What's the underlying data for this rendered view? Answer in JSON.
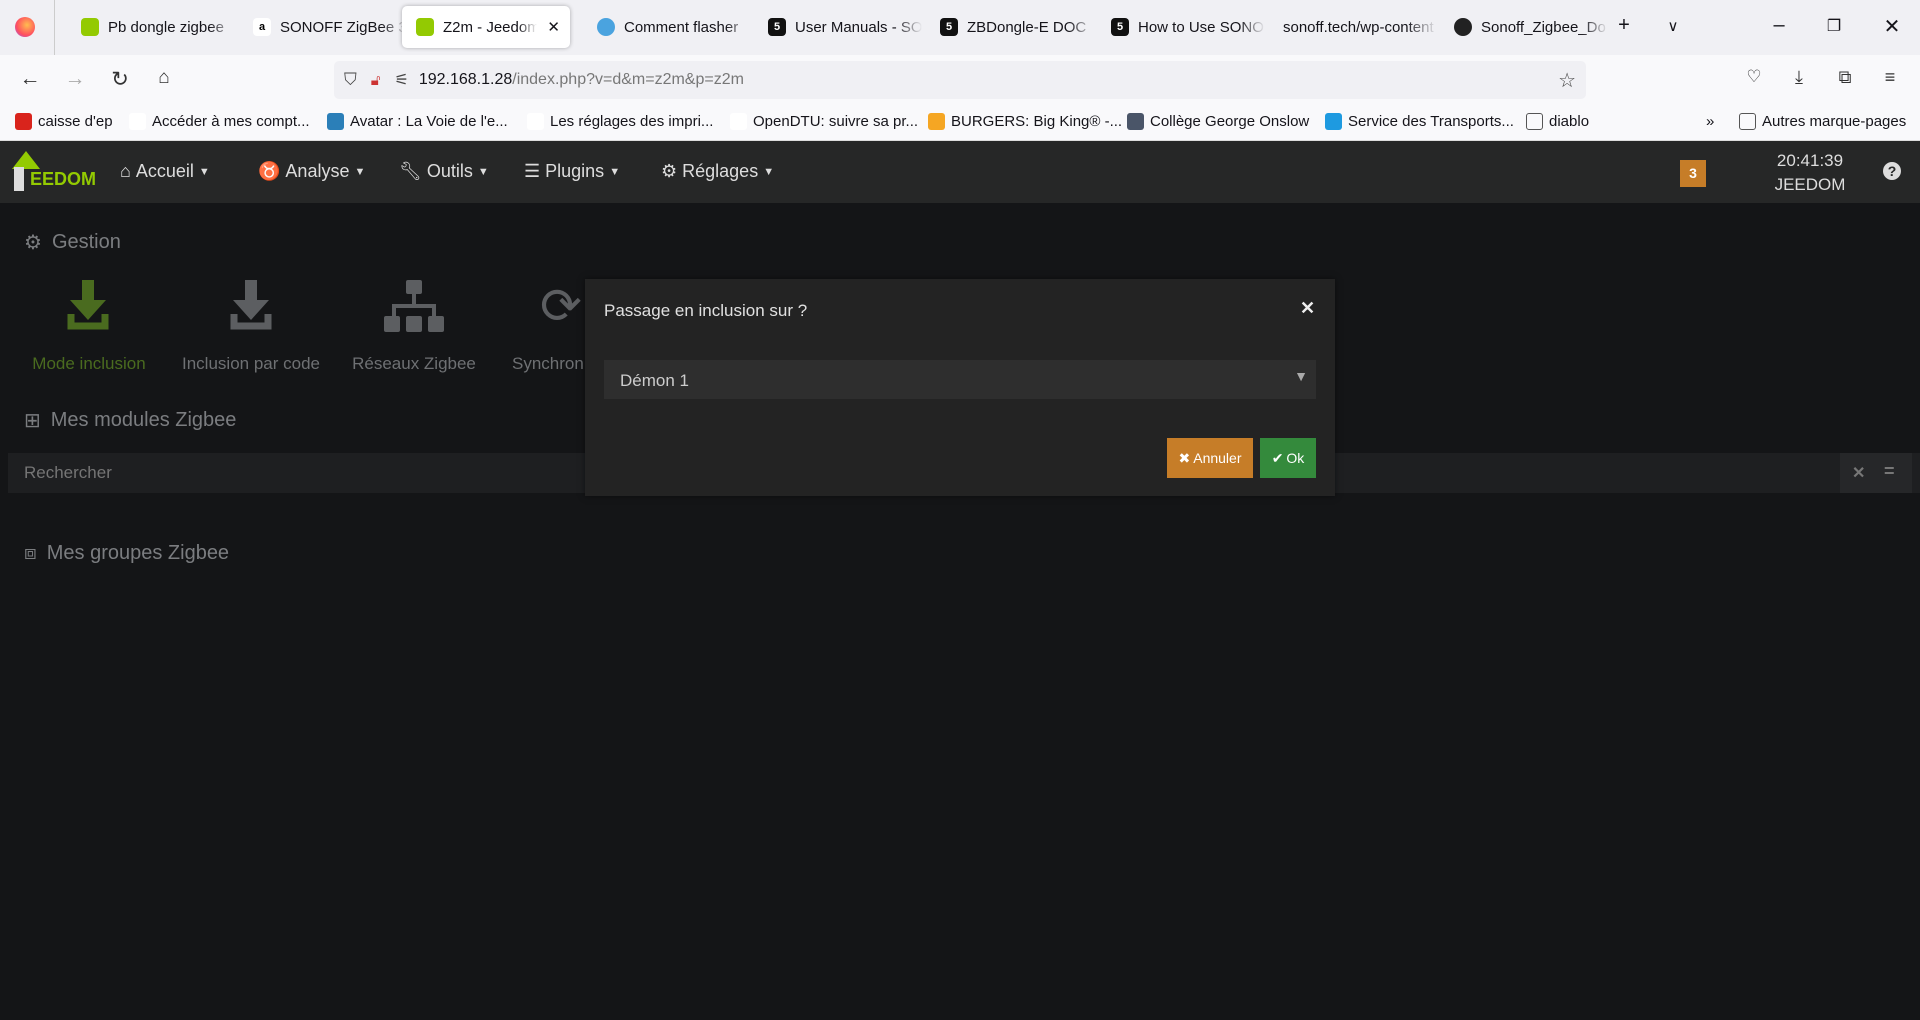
{
  "browser": {
    "tabs": [
      {
        "title": "Pb dongle zigbee",
        "icon": "jeedom-icon"
      },
      {
        "title": "SONOFF ZigBee 3",
        "icon": "amazon-icon"
      },
      {
        "title": "Z2m - Jeedom",
        "icon": "jeedom-icon",
        "active": true
      },
      {
        "title": "Comment flasher",
        "icon": "globe-icon"
      },
      {
        "title": "User Manuals - SO",
        "icon": "sonoff-icon"
      },
      {
        "title": "ZBDongle-E DOC",
        "icon": "sonoff-icon"
      },
      {
        "title": "How to Use SONO",
        "icon": "sonoff-icon"
      },
      {
        "title": "sonoff.tech/wp-content",
        "icon": "none"
      },
      {
        "title": "Sonoff_Zigbee_Do",
        "icon": "github-icon"
      }
    ],
    "url_host": "192.168.1.28",
    "url_path": "/index.php?v=d&m=z2m&p=z2m",
    "bookmarks": [
      "caisse d'ep",
      "Accéder à mes compt...",
      "Avatar : La Voie de l'e...",
      "Les réglages des impri...",
      "OpenDTU: suivre sa pr...",
      "BURGERS: Big King® -...",
      "Collège George Onslow",
      "Service des Transports...",
      "diablo"
    ],
    "other_bookmarks": "Autres marque-pages"
  },
  "app": {
    "logo": "EEDOM",
    "menu": [
      "Accueil",
      "Analyse",
      "Outils",
      "Plugins",
      "Réglages"
    ],
    "badge": "3",
    "time": "20:41:39",
    "user": "JEEDOM",
    "accent": "#93ca02"
  },
  "main": {
    "gestion_title": "Gestion",
    "actions": [
      "Mode inclusion",
      "Inclusion par code",
      "Réseaux Zigbee",
      "Synchron"
    ],
    "modules_title": "Mes modules Zigbee",
    "search_placeholder": "Rechercher",
    "groups_title": "Mes groupes Zigbee"
  },
  "modal": {
    "title": "Passage en inclusion sur ?",
    "selected": "Démon 1",
    "cancel": "Annuler",
    "ok": "Ok",
    "cancel_color": "#c67d28",
    "ok_color": "#348a3c"
  }
}
